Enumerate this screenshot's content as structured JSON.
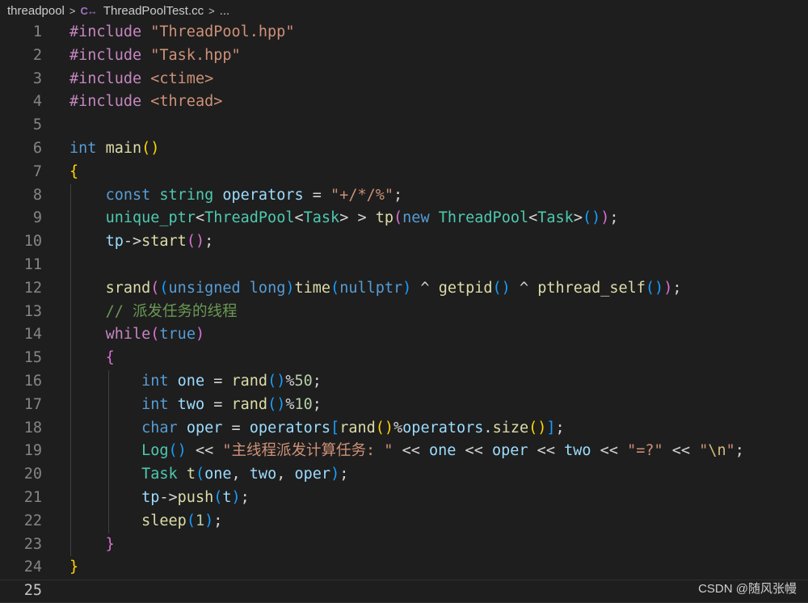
{
  "breadcrumb": {
    "folder": "threadpool",
    "file_icon": "cpp-file-icon",
    "file_icon_glyph": "C↔",
    "file": "ThreadPoolTest.cc",
    "more": "...",
    "separator": ">"
  },
  "editor": {
    "current_line": 25,
    "lines": [
      [
        [
          "#include ",
          "t-pre"
        ],
        [
          "\"ThreadPool.hpp\"",
          "t-str"
        ]
      ],
      [
        [
          "#include ",
          "t-pre"
        ],
        [
          "\"Task.hpp\"",
          "t-str"
        ]
      ],
      [
        [
          "#include ",
          "t-pre"
        ],
        [
          "<ctime>",
          "t-str"
        ]
      ],
      [
        [
          "#include ",
          "t-pre"
        ],
        [
          "<thread>",
          "t-str"
        ]
      ],
      [],
      [
        [
          "int",
          "t-kw"
        ],
        [
          " ",
          ""
        ],
        [
          "main",
          "t-fn"
        ],
        [
          "()",
          "t-b1"
        ]
      ],
      [
        [
          "{",
          "t-b1"
        ]
      ],
      [
        [
          "    ",
          ""
        ],
        [
          "const",
          "t-kw"
        ],
        [
          " ",
          ""
        ],
        [
          "string",
          "t-type"
        ],
        [
          " ",
          ""
        ],
        [
          "operators",
          "t-var"
        ],
        [
          " = ",
          "t-op"
        ],
        [
          "\"+/*/%\"",
          "t-str"
        ],
        [
          ";",
          "t-op"
        ]
      ],
      [
        [
          "    ",
          ""
        ],
        [
          "unique_ptr",
          "t-type"
        ],
        [
          "<",
          "t-op"
        ],
        [
          "ThreadPool",
          "t-type"
        ],
        [
          "<",
          "t-op"
        ],
        [
          "Task",
          "t-type"
        ],
        [
          "> > ",
          "t-op"
        ],
        [
          "tp",
          "t-fn"
        ],
        [
          "(",
          "t-b2"
        ],
        [
          "new",
          "t-kw"
        ],
        [
          " ",
          ""
        ],
        [
          "ThreadPool",
          "t-type"
        ],
        [
          "<",
          "t-op"
        ],
        [
          "Task",
          "t-type"
        ],
        [
          ">",
          "t-op"
        ],
        [
          "()",
          "t-b3"
        ],
        [
          ")",
          "t-b2"
        ],
        [
          ";",
          "t-op"
        ]
      ],
      [
        [
          "    ",
          ""
        ],
        [
          "tp",
          "t-var"
        ],
        [
          "->",
          "t-op"
        ],
        [
          "start",
          "t-fn"
        ],
        [
          "()",
          "t-b2"
        ],
        [
          ";",
          "t-op"
        ]
      ],
      [],
      [
        [
          "    ",
          ""
        ],
        [
          "srand",
          "t-fn"
        ],
        [
          "(",
          "t-b2"
        ],
        [
          "(",
          "t-b3"
        ],
        [
          "unsigned long",
          "t-kw"
        ],
        [
          ")",
          "t-b3"
        ],
        [
          "time",
          "t-fn"
        ],
        [
          "(",
          "t-b3"
        ],
        [
          "nullptr",
          "t-kw"
        ],
        [
          ")",
          "t-b3"
        ],
        [
          " ^ ",
          "t-op"
        ],
        [
          "getpid",
          "t-fn"
        ],
        [
          "()",
          "t-b3"
        ],
        [
          " ^ ",
          "t-op"
        ],
        [
          "pthread_self",
          "t-fn"
        ],
        [
          "()",
          "t-b3"
        ],
        [
          ")",
          "t-b2"
        ],
        [
          ";",
          "t-op"
        ]
      ],
      [
        [
          "    ",
          ""
        ],
        [
          "// 派发任务的线程",
          "t-com"
        ]
      ],
      [
        [
          "    ",
          ""
        ],
        [
          "while",
          "t-ctrl"
        ],
        [
          "(",
          "t-b2"
        ],
        [
          "true",
          "t-kw"
        ],
        [
          ")",
          "t-b2"
        ]
      ],
      [
        [
          "    ",
          ""
        ],
        [
          "{",
          "t-b2"
        ]
      ],
      [
        [
          "        ",
          ""
        ],
        [
          "int",
          "t-kw"
        ],
        [
          " ",
          ""
        ],
        [
          "one",
          "t-var"
        ],
        [
          " = ",
          "t-op"
        ],
        [
          "rand",
          "t-fn"
        ],
        [
          "()",
          "t-b3"
        ],
        [
          "%",
          "t-op"
        ],
        [
          "50",
          "t-num"
        ],
        [
          ";",
          "t-op"
        ]
      ],
      [
        [
          "        ",
          ""
        ],
        [
          "int",
          "t-kw"
        ],
        [
          " ",
          ""
        ],
        [
          "two",
          "t-var"
        ],
        [
          " = ",
          "t-op"
        ],
        [
          "rand",
          "t-fn"
        ],
        [
          "()",
          "t-b3"
        ],
        [
          "%",
          "t-op"
        ],
        [
          "10",
          "t-num"
        ],
        [
          ";",
          "t-op"
        ]
      ],
      [
        [
          "        ",
          ""
        ],
        [
          "char",
          "t-kw"
        ],
        [
          " ",
          ""
        ],
        [
          "oper",
          "t-var"
        ],
        [
          " = ",
          "t-op"
        ],
        [
          "operators",
          "t-var"
        ],
        [
          "[",
          "t-b3"
        ],
        [
          "rand",
          "t-fn"
        ],
        [
          "()",
          "t-b1"
        ],
        [
          "%",
          "t-op"
        ],
        [
          "operators",
          "t-var"
        ],
        [
          ".",
          "t-op"
        ],
        [
          "size",
          "t-fn"
        ],
        [
          "()",
          "t-b1"
        ],
        [
          "]",
          "t-b3"
        ],
        [
          ";",
          "t-op"
        ]
      ],
      [
        [
          "        ",
          ""
        ],
        [
          "Log",
          "t-type"
        ],
        [
          "()",
          "t-b3"
        ],
        [
          " << ",
          "t-op"
        ],
        [
          "\"主线程派发计算任务: \"",
          "t-str"
        ],
        [
          " << ",
          "t-op"
        ],
        [
          "one",
          "t-var"
        ],
        [
          " << ",
          "t-op"
        ],
        [
          "oper",
          "t-var"
        ],
        [
          " << ",
          "t-op"
        ],
        [
          "two",
          "t-var"
        ],
        [
          " << ",
          "t-op"
        ],
        [
          "\"=?\"",
          "t-str"
        ],
        [
          " << ",
          "t-op"
        ],
        [
          "\"",
          "t-str"
        ],
        [
          "\\n",
          "t-esc"
        ],
        [
          "\"",
          "t-str"
        ],
        [
          ";",
          "t-op"
        ]
      ],
      [
        [
          "        ",
          ""
        ],
        [
          "Task",
          "t-type"
        ],
        [
          " ",
          ""
        ],
        [
          "t",
          "t-fn"
        ],
        [
          "(",
          "t-b3"
        ],
        [
          "one",
          "t-var"
        ],
        [
          ", ",
          "t-op"
        ],
        [
          "two",
          "t-var"
        ],
        [
          ", ",
          "t-op"
        ],
        [
          "oper",
          "t-var"
        ],
        [
          ")",
          "t-b3"
        ],
        [
          ";",
          "t-op"
        ]
      ],
      [
        [
          "        ",
          ""
        ],
        [
          "tp",
          "t-var"
        ],
        [
          "->",
          "t-op"
        ],
        [
          "push",
          "t-fn"
        ],
        [
          "(",
          "t-b3"
        ],
        [
          "t",
          "t-var"
        ],
        [
          ")",
          "t-b3"
        ],
        [
          ";",
          "t-op"
        ]
      ],
      [
        [
          "        ",
          ""
        ],
        [
          "sleep",
          "t-fn"
        ],
        [
          "(",
          "t-b3"
        ],
        [
          "1",
          "t-num"
        ],
        [
          ")",
          "t-b3"
        ],
        [
          ";",
          "t-op"
        ]
      ],
      [
        [
          "    ",
          ""
        ],
        [
          "}",
          "t-b2"
        ]
      ],
      [
        [
          "}",
          "t-b1"
        ]
      ],
      []
    ]
  },
  "watermark": "CSDN @随风张幔"
}
